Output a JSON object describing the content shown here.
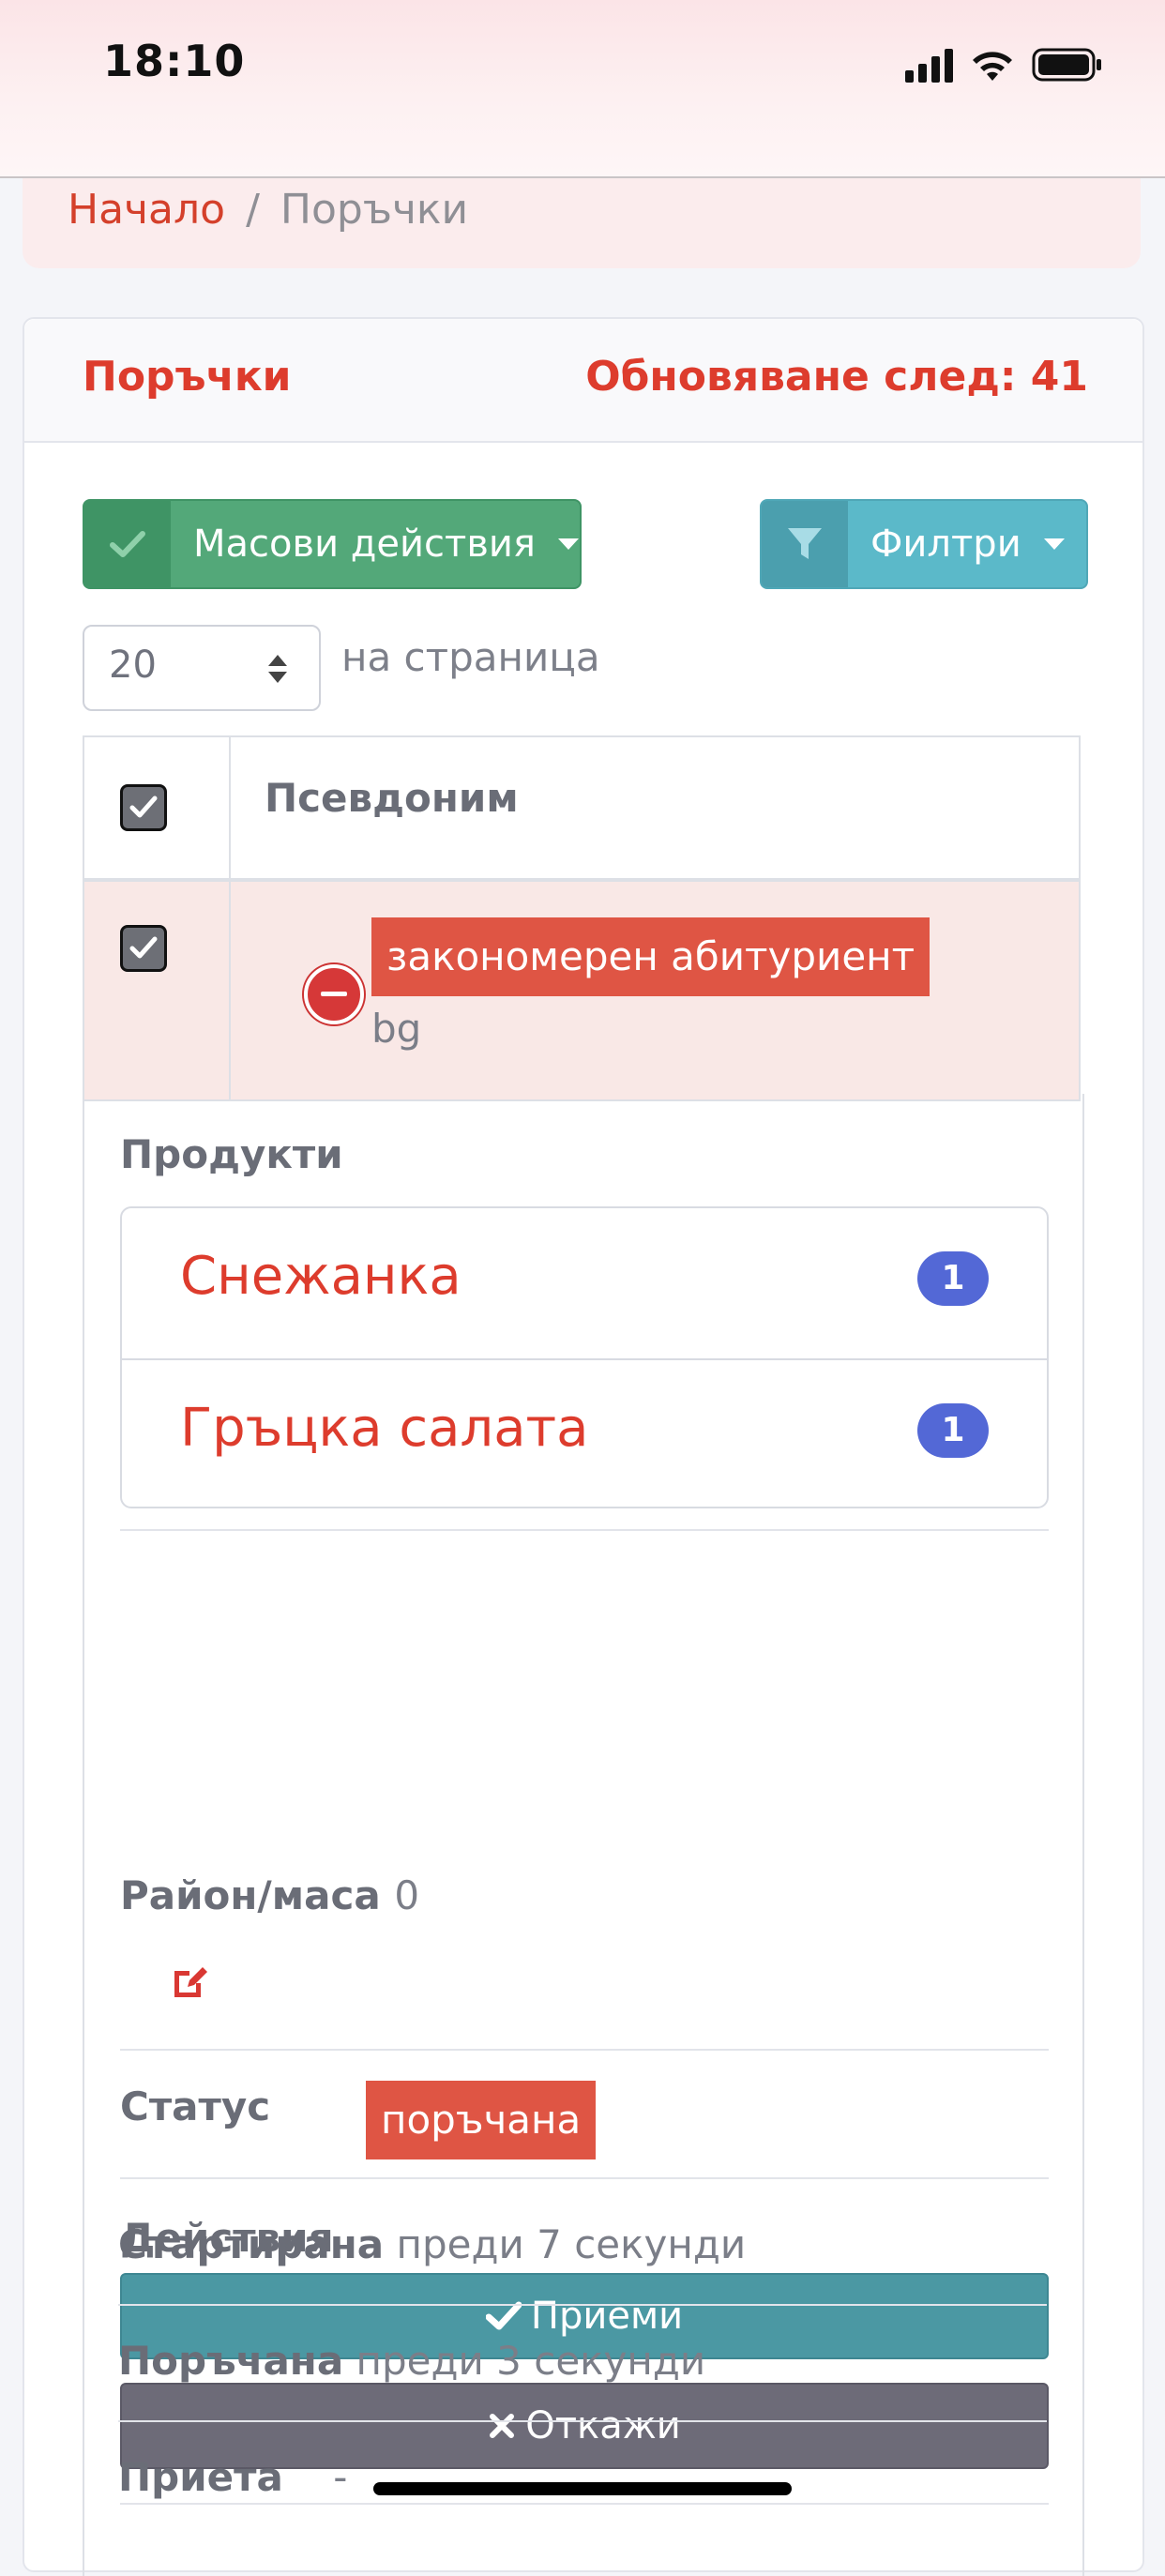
{
  "status_bar": {
    "time": "18:10",
    "icons": [
      "cellular-signal-icon",
      "wifi-icon",
      "battery-icon"
    ]
  },
  "breadcrumb": {
    "home": "Начало",
    "separator": "/",
    "current": "Поръчки"
  },
  "card": {
    "title": "Поръчки",
    "refresh_label": "Обновяване след: 41"
  },
  "toolbar": {
    "mass_actions": "Масови действия",
    "filters": "Филтри"
  },
  "pagination": {
    "per_page_value": "20",
    "per_page_label": "на страница"
  },
  "table": {
    "header": {
      "column": "Псевдоним",
      "select_all_checked": true
    },
    "row": {
      "checked": true,
      "nickname": "закономерен абитуриент",
      "subtitle": "bg",
      "products_label": "Продукти",
      "products": [
        {
          "name": "Снежанка",
          "count": "1"
        },
        {
          "name": "Гръцка салата",
          "count": "1"
        }
      ],
      "area_label": "Район/маса",
      "area_value": "0",
      "status_label": "Статус",
      "status_value": "поръчана",
      "actions_label": "Действия",
      "accept_label": "Приеми",
      "cancel_label": "Откажи",
      "started_label": "Стартирана",
      "started_value": "преди 7 секунди",
      "ordered_label": "Поръчана",
      "ordered_value": "преди 3 секунди",
      "accepted_label": "Приета",
      "accepted_value": "-"
    }
  },
  "colors": {
    "accent_red": "#dd3c2d",
    "badge_blue": "#5368d6",
    "accept_teal": "#4b98a3",
    "cancel_gray": "#6d6b78",
    "mass_green": "#53a879",
    "filter_cyan": "#5bb9c9"
  }
}
